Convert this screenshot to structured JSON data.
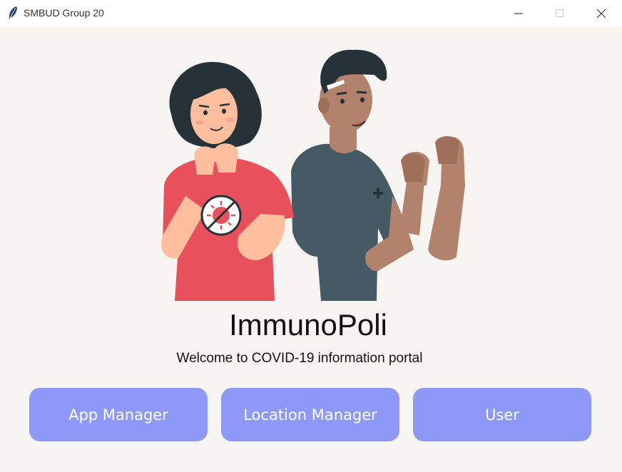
{
  "window": {
    "title": "SMBUD Group 20",
    "icon": "feather-icon"
  },
  "colors": {
    "background": "#f7f5f2",
    "button_bg": "#8e98f7",
    "button_text": "#ffffff",
    "shirt_red": "#e8505b",
    "shirt_slate": "#455a64"
  },
  "main": {
    "title": "ImmunoPoli",
    "subtitle": "Welcome to COVID-19 information portal"
  },
  "buttons": {
    "app_manager": "App Manager",
    "location_manager": "Location Manager",
    "user": "User"
  }
}
